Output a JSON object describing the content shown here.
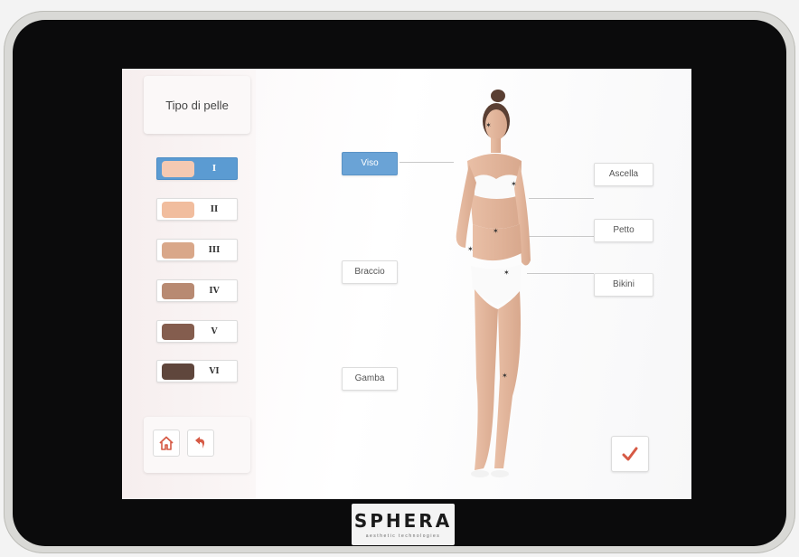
{
  "skin_panel": {
    "title": "Tipo di pelle",
    "types": [
      {
        "label": "I",
        "color": "#f4c9b2",
        "selected": true
      },
      {
        "label": "II",
        "color": "#f1bd9e",
        "selected": false
      },
      {
        "label": "III",
        "color": "#d9a789",
        "selected": false
      },
      {
        "label": "IV",
        "color": "#b88a72",
        "selected": false
      },
      {
        "label": "V",
        "color": "#845d4e",
        "selected": false
      },
      {
        "label": "VI",
        "color": "#5f463c",
        "selected": false
      }
    ]
  },
  "body_areas": {
    "left": [
      {
        "label": "Viso",
        "selected": true
      },
      {
        "label": "Braccio",
        "selected": false
      },
      {
        "label": "Gamba",
        "selected": false
      }
    ],
    "right": [
      {
        "label": "Ascella",
        "selected": false
      },
      {
        "label": "Petto",
        "selected": false
      },
      {
        "label": "Bikini",
        "selected": false
      }
    ]
  },
  "nav": {
    "home_icon": "home-icon",
    "back_icon": "undo-arrow-icon",
    "confirm_icon": "checkmark-icon"
  },
  "brand": {
    "logo_text": "SPHERA",
    "tagline": "aesthetic technologies"
  },
  "colors": {
    "accent_blue": "#5b9bd2",
    "icon_red": "#d65a45",
    "bezel": "#0b0b0c"
  }
}
